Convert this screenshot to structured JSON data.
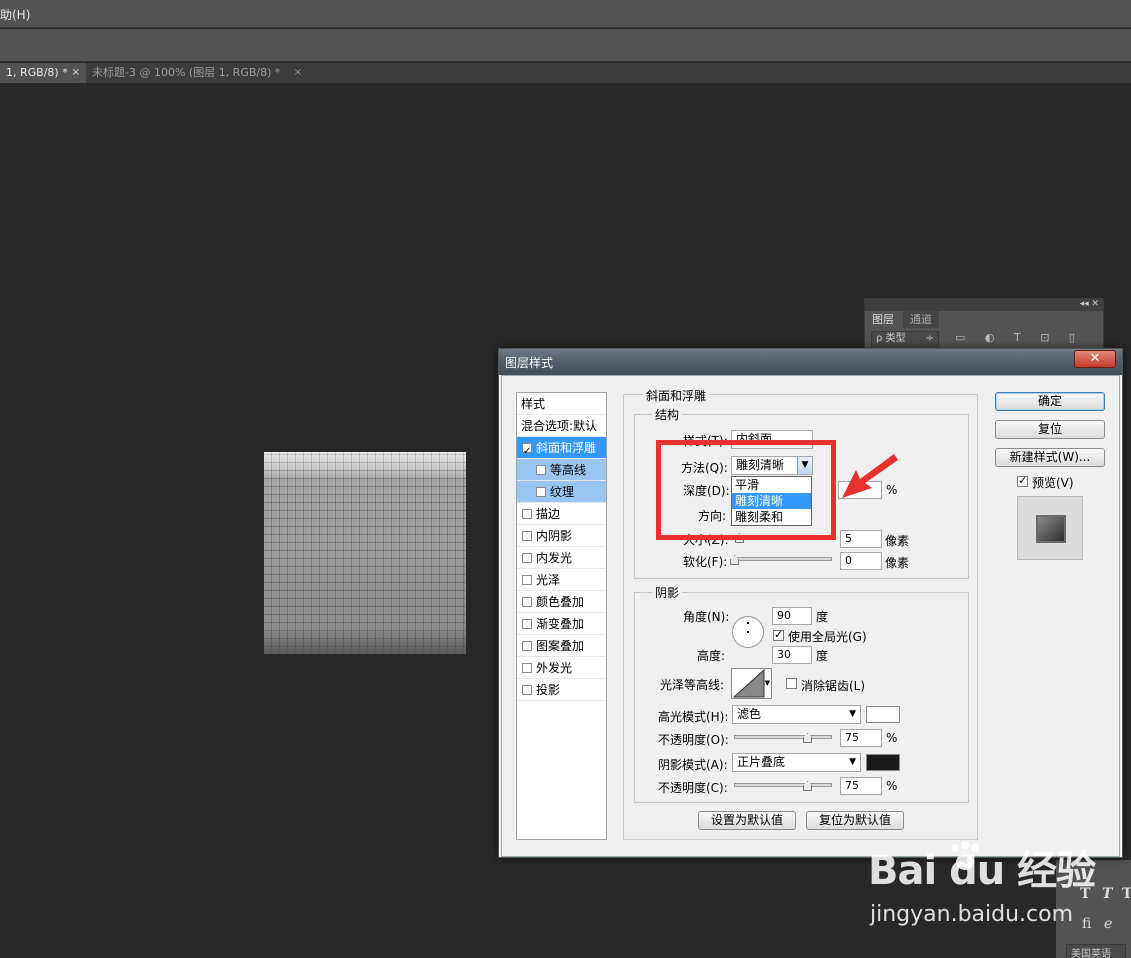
{
  "app": {
    "menu_partial": "助(H)",
    "tabs": [
      {
        "label": "1, RGB/8) *",
        "close": "×"
      },
      {
        "label": "未标题-3 @ 100% (图层 1, RGB/8) *",
        "close": "×"
      }
    ]
  },
  "layers_panel": {
    "collapse_btns": "◂◂ ✕",
    "tabs": [
      "图层",
      "通道"
    ],
    "filter_label": "ρ 类型",
    "filter_arrow": "÷",
    "icons": [
      "image-icon",
      "adjust-icon",
      "type-icon",
      "shape-icon",
      "smart-icon"
    ]
  },
  "right_panel": {
    "glyphs": [
      "T",
      "T",
      "T",
      "fi",
      "ℯ"
    ],
    "lang": "美国英语"
  },
  "dialog": {
    "title": "图层样式",
    "close_label": "✕",
    "style_list": {
      "header": "样式",
      "items": [
        {
          "label": "混合选项:默认",
          "checked": null
        },
        {
          "label": "斜面和浮雕",
          "checked": true
        },
        {
          "label": "等高线",
          "checked": false
        },
        {
          "label": "纹理",
          "checked": false
        },
        {
          "label": "描边",
          "checked": false
        },
        {
          "label": "内阴影",
          "checked": false
        },
        {
          "label": "内发光",
          "checked": false
        },
        {
          "label": "光泽",
          "checked": false
        },
        {
          "label": "颜色叠加",
          "checked": false
        },
        {
          "label": "渐变叠加",
          "checked": false
        },
        {
          "label": "图案叠加",
          "checked": false
        },
        {
          "label": "外发光",
          "checked": false
        },
        {
          "label": "投影",
          "checked": false
        }
      ]
    },
    "bevel": {
      "section_title": "斜面和浮雕",
      "structure_title": "结构",
      "style_label": "样式(T):",
      "style_value": "内斜面",
      "method_label": "方法(Q):",
      "method_value": "雕刻清晰",
      "method_options": [
        "平滑",
        "雕刻清晰",
        "雕刻柔和"
      ],
      "method_selected": "雕刻清晰",
      "depth_label": "深度(D):",
      "depth_unit": "%",
      "direction_label": "方向:",
      "size_label": "大小(Z):",
      "size_value": "5",
      "size_unit": "像素",
      "soften_label": "软化(F):",
      "soften_value": "0",
      "soften_unit": "像素"
    },
    "shading": {
      "title": "阴影",
      "angle_label": "角度(N):",
      "angle_value": "90",
      "angle_unit": "度",
      "global_light_label": "使用全局光(G)",
      "global_light_checked": true,
      "altitude_label": "高度:",
      "altitude_value": "30",
      "altitude_unit": "度",
      "gloss_contour_label": "光泽等高线:",
      "anti_alias_label": "消除锯齿(L)",
      "anti_alias_checked": false,
      "highlight_mode_label": "高光模式(H):",
      "highlight_mode_value": "滤色",
      "highlight_color": "#ffffff",
      "highlight_opacity_label": "不透明度(O):",
      "highlight_opacity_value": "75",
      "shadow_mode_label": "阴影模式(A):",
      "shadow_mode_value": "正片叠底",
      "shadow_color": "#1a1a1a",
      "shadow_opacity_label": "不透明度(C):",
      "shadow_opacity_value": "75",
      "percent": "%"
    },
    "buttons": {
      "make_default": "设置为默认值",
      "reset_default": "复位为默认值",
      "ok": "确定",
      "reset": "复位",
      "new_style": "新建样式(W)...",
      "preview_label": "预览(V)",
      "preview_checked": true
    }
  },
  "annotation": {
    "highlight_color": "#e8302f"
  },
  "watermark": {
    "logo": "Bai du 经验",
    "url": "jingyan.baidu.com"
  }
}
